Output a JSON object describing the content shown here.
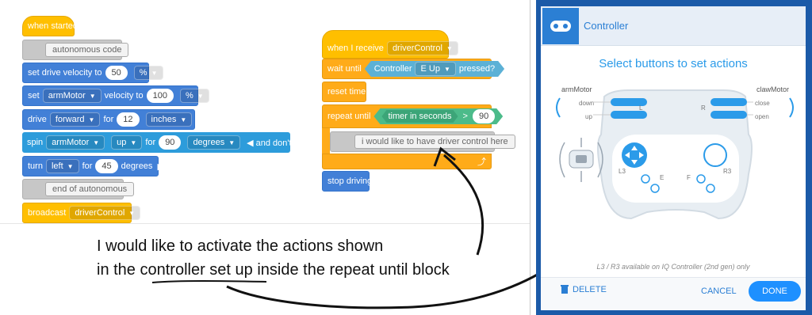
{
  "left_stack": {
    "hat": "when started",
    "autonomous_code": "autonomous code",
    "set_velocity": {
      "label": "set drive velocity to",
      "value": "50",
      "unit": "%"
    },
    "set_motor": {
      "label": "set",
      "motor": "armMotor",
      "mid": "velocity to",
      "value": "100",
      "unit": "%"
    },
    "drive": {
      "label": "drive",
      "dir": "forward",
      "mid": "for",
      "value": "12",
      "unit": "inches",
      "play": "▶"
    },
    "spin": {
      "label": "spin",
      "motor": "armMotor",
      "dir": "up",
      "mid": "for",
      "value": "90",
      "unit": "degrees",
      "wait": "◀ and don't wait"
    },
    "turn": {
      "label": "turn",
      "dir": "left",
      "mid": "for",
      "value": "45",
      "unit": "degrees",
      "play": "▶"
    },
    "end_autonomous": "end of autonomous",
    "broadcast": {
      "label": "broadcast",
      "msg": "driverControl"
    }
  },
  "right_stack": {
    "hat": {
      "label": "when I receive",
      "msg": "driverControl"
    },
    "wait_until": {
      "label": "wait until",
      "controller": "Controller",
      "button": "E Up",
      "pressed": "pressed?"
    },
    "reset_timer": "reset timer",
    "repeat_until": {
      "label": "repeat until",
      "sensor": "timer in seconds",
      "op": ">",
      "value": "90"
    },
    "comment": "i would like to have driver control here",
    "loop_arrow": "⤴",
    "stop": "stop driving"
  },
  "annotation": {
    "line1": "I would like to activate the actions shown",
    "line2": "in the controller set up inside the repeat until block"
  },
  "controller_panel": {
    "title": "Controller",
    "select_title": "Select buttons to set actions",
    "arm_motor": "armMotor",
    "claw_motor": "clawMotor",
    "down": "down",
    "up": "up",
    "close": "close",
    "open": "open",
    "l1": "L",
    "r1": "R",
    "l3": "L3",
    "r3": "R3",
    "e": "E",
    "f": "F",
    "note": "L3 / R3 available on IQ Controller (2nd gen) only",
    "delete": "DELETE",
    "cancel": "CANCEL",
    "done": "DONE",
    "accent": "#2b9be9",
    "brand": "#1b5aa8"
  }
}
